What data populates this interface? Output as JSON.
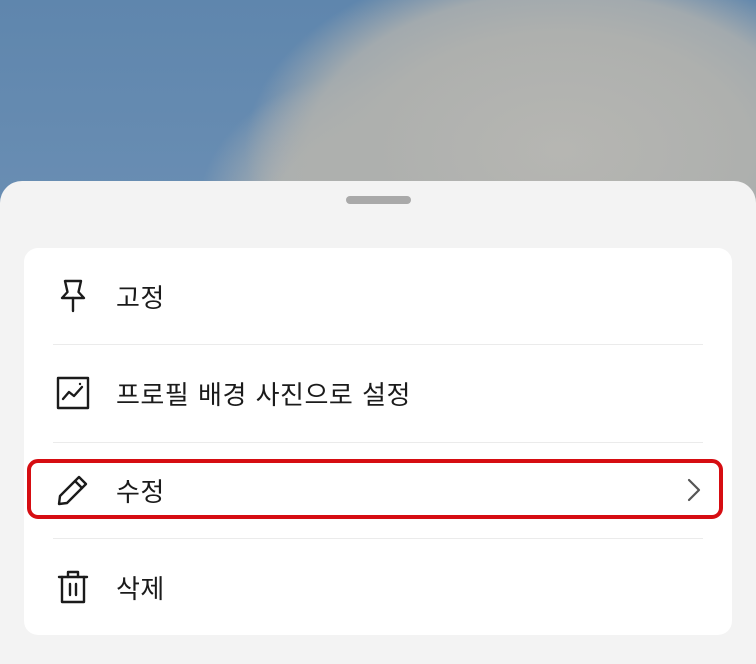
{
  "sheet": {
    "items": [
      {
        "label": "고정",
        "icon": "pin-icon"
      },
      {
        "label": "프로필 배경 사진으로 설정",
        "icon": "image-icon"
      },
      {
        "label": "수정",
        "icon": "pencil-icon",
        "has_submenu": true
      },
      {
        "label": "삭제",
        "icon": "trash-icon"
      }
    ]
  },
  "highlight": {
    "target": "edit-menu-item",
    "color": "#d60d12"
  },
  "colors": {
    "sheet_bg": "#f3f3f3",
    "card_bg": "#ffffff",
    "text": "#1b1b1b"
  }
}
